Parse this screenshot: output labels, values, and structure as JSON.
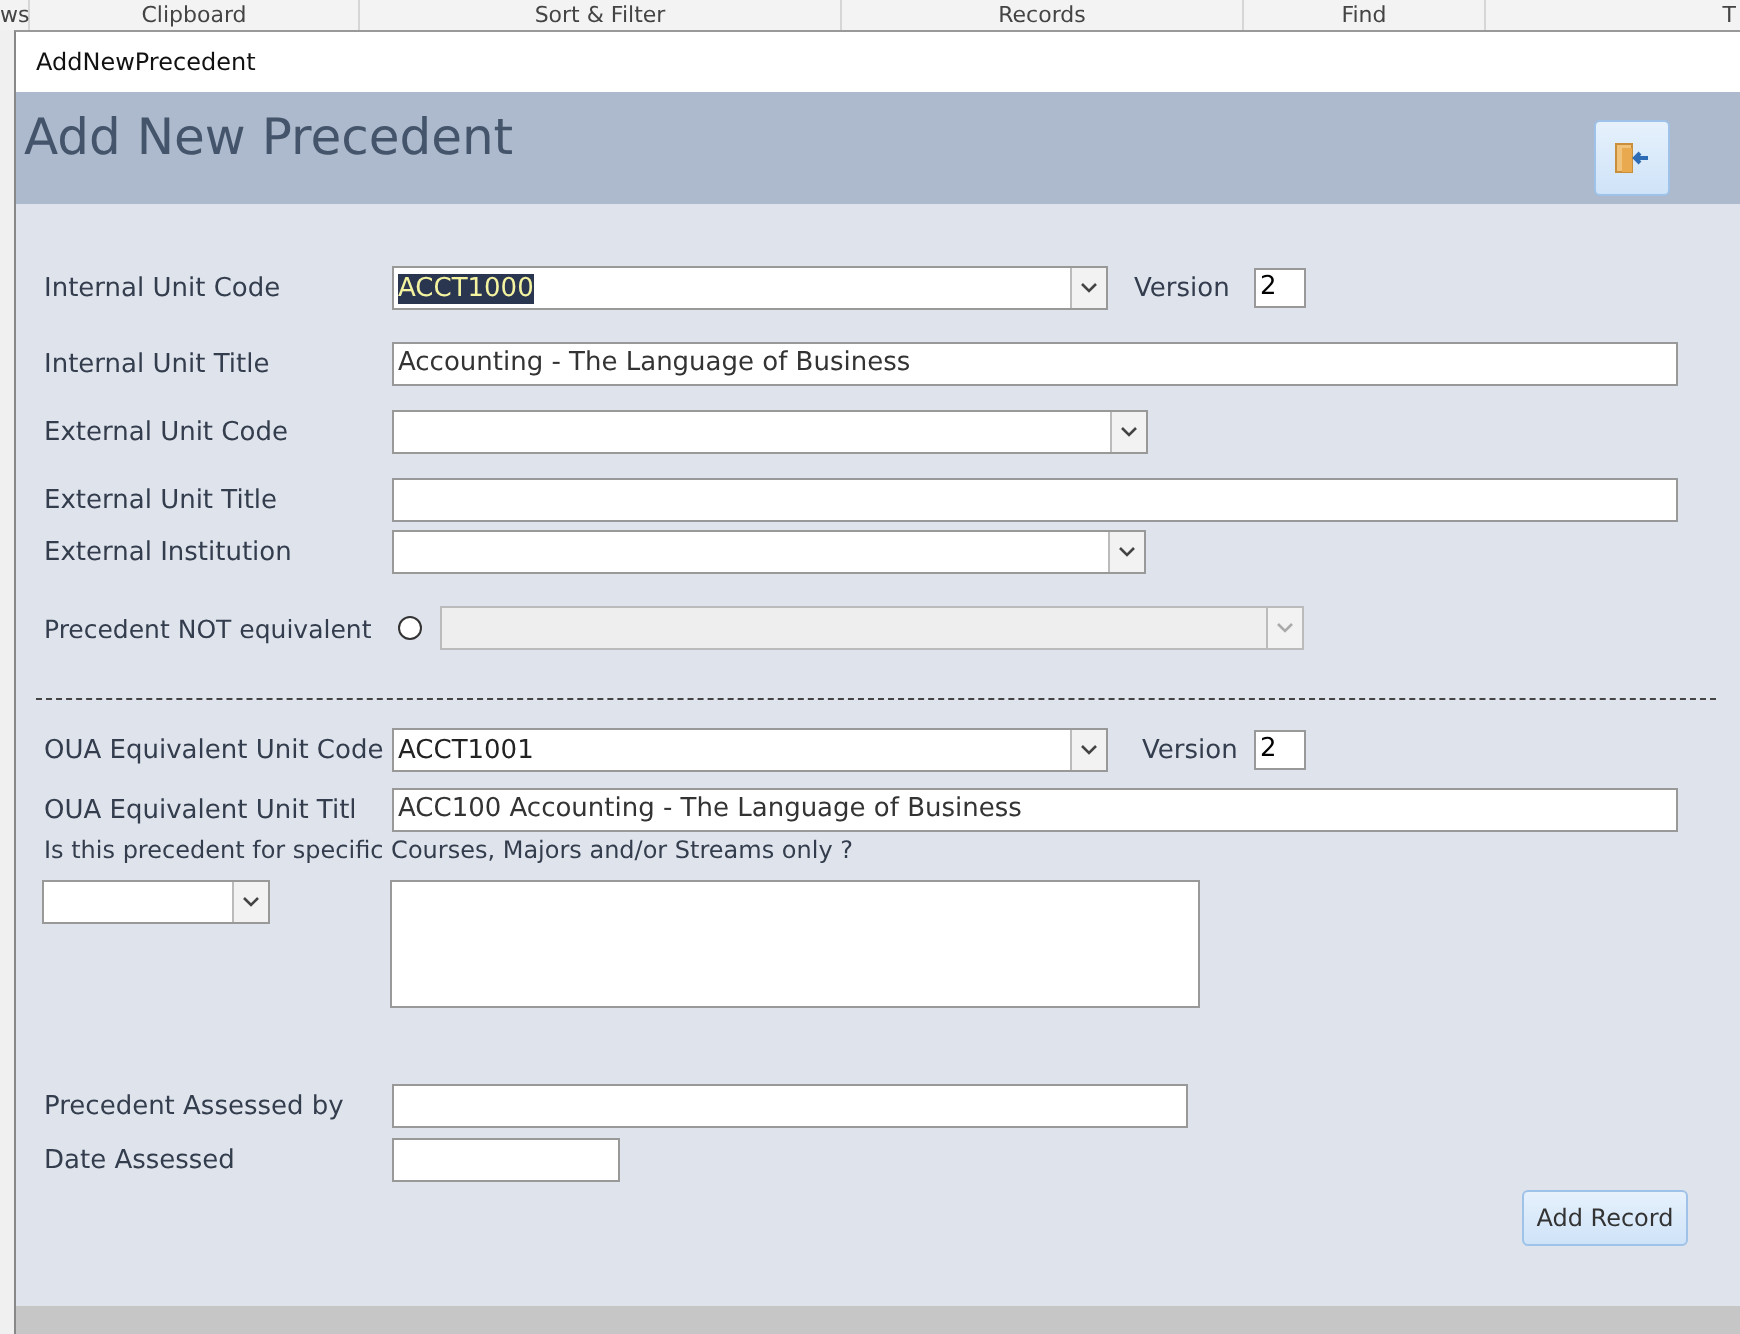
{
  "ribbon_groups": [
    "ws",
    "Clipboard",
    "Sort & Filter",
    "Records",
    "Find",
    "T"
  ],
  "window": {
    "title": "AddNewPrecedent"
  },
  "header": {
    "title": "Add New Precedent"
  },
  "fields": [
    {
      "kind": "combo",
      "label": "Internal Unit Code",
      "value": "ACCT1000",
      "selected": true,
      "version": {
        "label": "Version",
        "value": "2"
      }
    },
    {
      "kind": "text",
      "label": "Internal Unit Title",
      "value": "Accounting - The Language of Business"
    },
    {
      "kind": "combo",
      "label": "External Unit Code"
    },
    {
      "kind": "text",
      "label": "External Unit Title"
    },
    {
      "kind": "combo",
      "label": "External Institution"
    },
    {
      "kind": "radio-combo",
      "label": "Precedent NOT equivalent",
      "checked": false,
      "disabled": true
    }
  ],
  "oua_fields": [
    {
      "kind": "combo",
      "label": "OUA Equivalent Unit Code",
      "value": "ACCT1001",
      "selected": false,
      "version": {
        "label": "Version",
        "value": "2"
      }
    },
    {
      "kind": "text",
      "label": "OUA Equivalent Unit Titl",
      "value": "ACC100 Accounting - The Language of Business"
    }
  ],
  "question": "Is this precedent for specific Courses, Majors and/or Streams only ?",
  "assessment_fields": [
    {
      "kind": "text",
      "label": "Precedent Assessed by"
    },
    {
      "kind": "text",
      "label": "Date Assessed"
    }
  ],
  "add_button": "Add Record"
}
